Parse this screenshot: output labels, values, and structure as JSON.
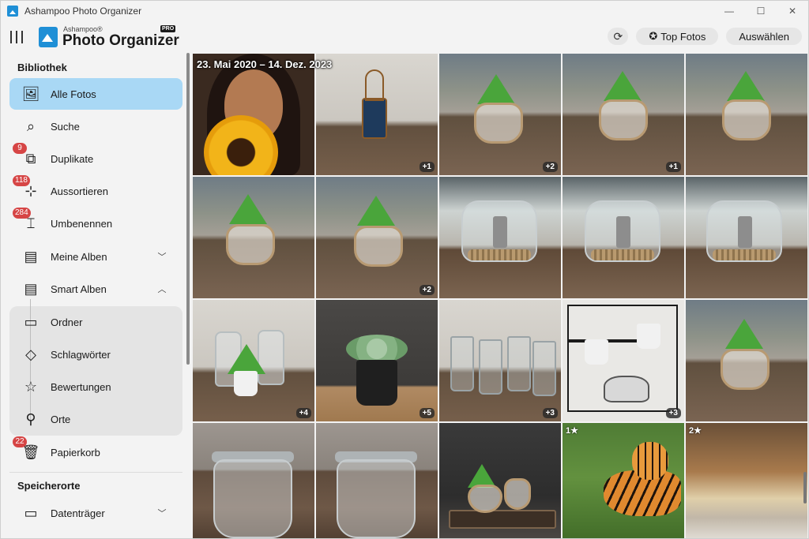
{
  "window": {
    "title": "Ashampoo Photo Organizer",
    "controls": {
      "minimize": "—",
      "maximize": "☐",
      "close": "✕"
    }
  },
  "header": {
    "logo_small": "Ashampoo®",
    "logo_big": "Photo Organizer",
    "logo_pro": "PRO",
    "refresh_icon": "⟳",
    "top_fotos_icon": "✪",
    "top_fotos": "Top Fotos",
    "auswaehlen": "Auswählen"
  },
  "sidebar": {
    "bibliothek": "Bibliothek",
    "speicherorte": "Speicherorte",
    "items": [
      {
        "label": "Alle Fotos",
        "icon": "🖼",
        "badge": null,
        "chev": null
      },
      {
        "label": "Suche",
        "icon": "⌕",
        "badge": null,
        "chev": null
      },
      {
        "label": "Duplikate",
        "icon": "⧉",
        "badge": "9",
        "chev": null
      },
      {
        "label": "Aussortieren",
        "icon": "⊹",
        "badge": "118",
        "chev": null
      },
      {
        "label": "Umbenennen",
        "icon": "⌶",
        "badge": "284",
        "chev": null
      },
      {
        "label": "Meine Alben",
        "icon": "▤",
        "badge": null,
        "chev": "﹀"
      },
      {
        "label": "Smart Alben",
        "icon": "▤",
        "badge": null,
        "chev": "︿"
      },
      {
        "label": "Ordner",
        "icon": "▭",
        "badge": null,
        "chev": null
      },
      {
        "label": "Schlagwörter",
        "icon": "◇",
        "badge": null,
        "chev": null
      },
      {
        "label": "Bewertungen",
        "icon": "☆",
        "badge": null,
        "chev": null
      },
      {
        "label": "Orte",
        "icon": "⚲",
        "badge": null,
        "chev": null
      },
      {
        "label": "Papierkorb",
        "icon": "🗑",
        "badge": "22",
        "chev": null
      },
      {
        "label": "Datenträger",
        "icon": "▭",
        "badge": null,
        "chev": "﹀"
      }
    ]
  },
  "grid": {
    "date_range": "23. Mai 2020 – 14. Dez. 2023",
    "tiles": [
      {
        "count": "",
        "rating": ""
      },
      {
        "count": "+1",
        "rating": ""
      },
      {
        "count": "+2",
        "rating": ""
      },
      {
        "count": "+1",
        "rating": ""
      },
      {
        "count": "",
        "rating": ""
      },
      {
        "count": "",
        "rating": ""
      },
      {
        "count": "+2",
        "rating": ""
      },
      {
        "count": "",
        "rating": ""
      },
      {
        "count": "",
        "rating": ""
      },
      {
        "count": "",
        "rating": ""
      },
      {
        "count": "+4",
        "rating": ""
      },
      {
        "count": "+5",
        "rating": ""
      },
      {
        "count": "+3",
        "rating": ""
      },
      {
        "count": "+3",
        "rating": ""
      },
      {
        "count": "",
        "rating": ""
      },
      {
        "count": "",
        "rating": ""
      },
      {
        "count": "",
        "rating": ""
      },
      {
        "count": "",
        "rating": ""
      },
      {
        "count": "",
        "rating": "1★"
      },
      {
        "count": "",
        "rating": "2★"
      }
    ]
  }
}
